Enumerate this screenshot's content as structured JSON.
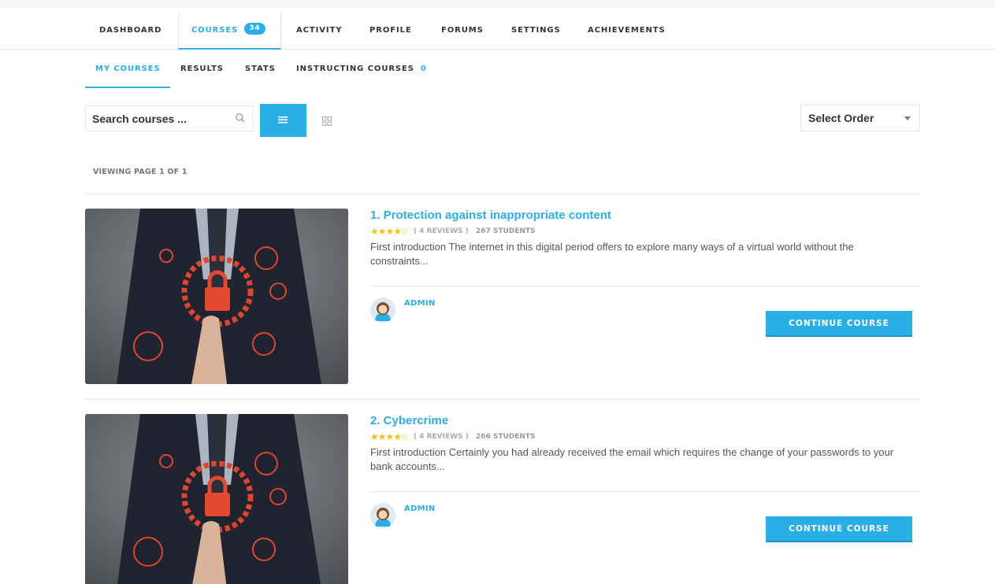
{
  "main_nav": {
    "tabs": [
      {
        "label": "DASHBOARD"
      },
      {
        "label": "COURSES",
        "badge": "34"
      },
      {
        "label": "ACTIVITY"
      },
      {
        "label": "PROFILE"
      },
      {
        "label": "FORUMS"
      },
      {
        "label": "SETTINGS"
      },
      {
        "label": "ACHIEVEMENTS"
      }
    ],
    "active": "COURSES"
  },
  "sub_nav": {
    "tabs": [
      {
        "label": "MY COURSES"
      },
      {
        "label": "RESULTS"
      },
      {
        "label": "STATS"
      },
      {
        "label": "INSTRUCTING COURSES",
        "count": "0"
      }
    ],
    "active": "MY COURSES"
  },
  "toolbar": {
    "search_placeholder": "Search courses ...",
    "search_icon": "search-icon",
    "list_view_icon": "list-view-icon",
    "grid_view_icon": "grid-view-icon",
    "order_label": "Select Order"
  },
  "pagination": {
    "viewing": "VIEWING PAGE 1 OF 1"
  },
  "courses": [
    {
      "title": "1. Protection against inappropriate content",
      "rating_stars": 4,
      "reviews": "( 4 REVIEWS )",
      "students": "267 STUDENTS",
      "description": "First introduction The internet in this digital period offers to explore many ways of a virtual world without the constraints...",
      "author": "ADMIN",
      "button": "CONTINUE COURSE"
    },
    {
      "title": "2. Cybercrime",
      "rating_stars": 4,
      "reviews": "( 4 REVIEWS )",
      "students": "266 STUDENTS",
      "description": "First introduction Certainly you had already received the email which requires the change of your passwords to your bank accounts...",
      "author": "ADMIN",
      "button": "CONTINUE COURSE"
    }
  ],
  "colors": {
    "accent": "#2aaee6",
    "star": "#f5c015"
  }
}
